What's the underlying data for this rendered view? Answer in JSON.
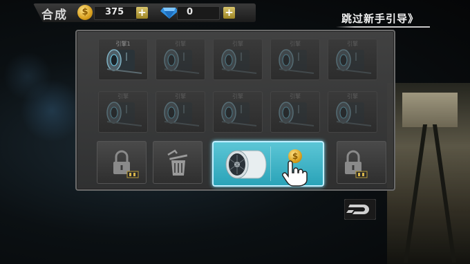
{
  "header": {
    "title": "合成",
    "coins": "375",
    "coin_symbol": "$",
    "gems": "0",
    "plus": "+",
    "skip_tutorial": "跳过新手引导》"
  },
  "grid": {
    "slots": [
      {
        "label": "引擎1",
        "active": true
      },
      {
        "label": "引擎",
        "active": false
      },
      {
        "label": "引擎",
        "active": false
      },
      {
        "label": "引擎",
        "active": false
      },
      {
        "label": "引擎",
        "active": false
      },
      {
        "label": "引擎",
        "active": false
      },
      {
        "label": "引擎",
        "active": false
      },
      {
        "label": "引擎",
        "active": false
      },
      {
        "label": "引擎",
        "active": false
      },
      {
        "label": "引擎",
        "active": false
      }
    ]
  },
  "bottom_row": {
    "left_slot_icon": "lock-icon",
    "trash_icon": "trash-icon",
    "selected_item_icon": "jet-engine-icon",
    "selected_coin_symbol": "$",
    "right_slot_icon": "lock-icon"
  },
  "colors": {
    "accent_teal": "#2aa3b8",
    "coin_gold": "#d9a01e",
    "gem_blue": "#2f8fe0"
  }
}
